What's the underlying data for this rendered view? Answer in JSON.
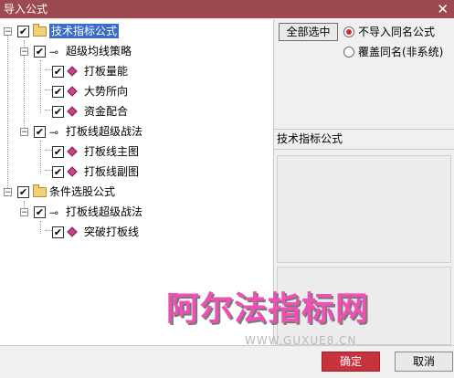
{
  "window": {
    "title": "导入公式",
    "close_glyph": "✕"
  },
  "tree": {
    "expander_minus": "−",
    "check_glyph": "✔",
    "strategy_glyph": "⊸",
    "nodes": [
      {
        "label": "技术指标公式",
        "kind": "folder",
        "level": 0,
        "selected": true
      },
      {
        "label": "超级均线策略",
        "kind": "strategy",
        "level": 1
      },
      {
        "label": "打板量能",
        "kind": "formula",
        "level": 2
      },
      {
        "label": "大势所向",
        "kind": "formula",
        "level": 2
      },
      {
        "label": "资金配合",
        "kind": "formula",
        "level": 2
      },
      {
        "label": "打板线超级战法",
        "kind": "strategy",
        "level": 1
      },
      {
        "label": "打板线主图",
        "kind": "formula",
        "level": 2
      },
      {
        "label": "打板线副图",
        "kind": "formula",
        "level": 2
      },
      {
        "label": "条件选股公式",
        "kind": "folder",
        "level": 0
      },
      {
        "label": "打板线超级战法",
        "kind": "strategy",
        "level": 1
      },
      {
        "label": "突破打板线",
        "kind": "formula",
        "level": 2
      }
    ]
  },
  "right": {
    "select_all": "全部选中",
    "options": [
      {
        "label": "不导入同名公式",
        "checked": true
      },
      {
        "label": "覆盖同名(非系统)",
        "checked": false
      }
    ],
    "section_title": "技术指标公式"
  },
  "footer": {
    "ok": "确定",
    "cancel": "取消"
  },
  "watermark": {
    "cn": "阿尔法指标网",
    "url": "WWW.GUXUE8.CN"
  },
  "colors": {
    "title_bar": "#9c4a50",
    "ok_button": "#c8323c",
    "selection": "#3a6bc9",
    "watermark": "#f14eb6"
  }
}
